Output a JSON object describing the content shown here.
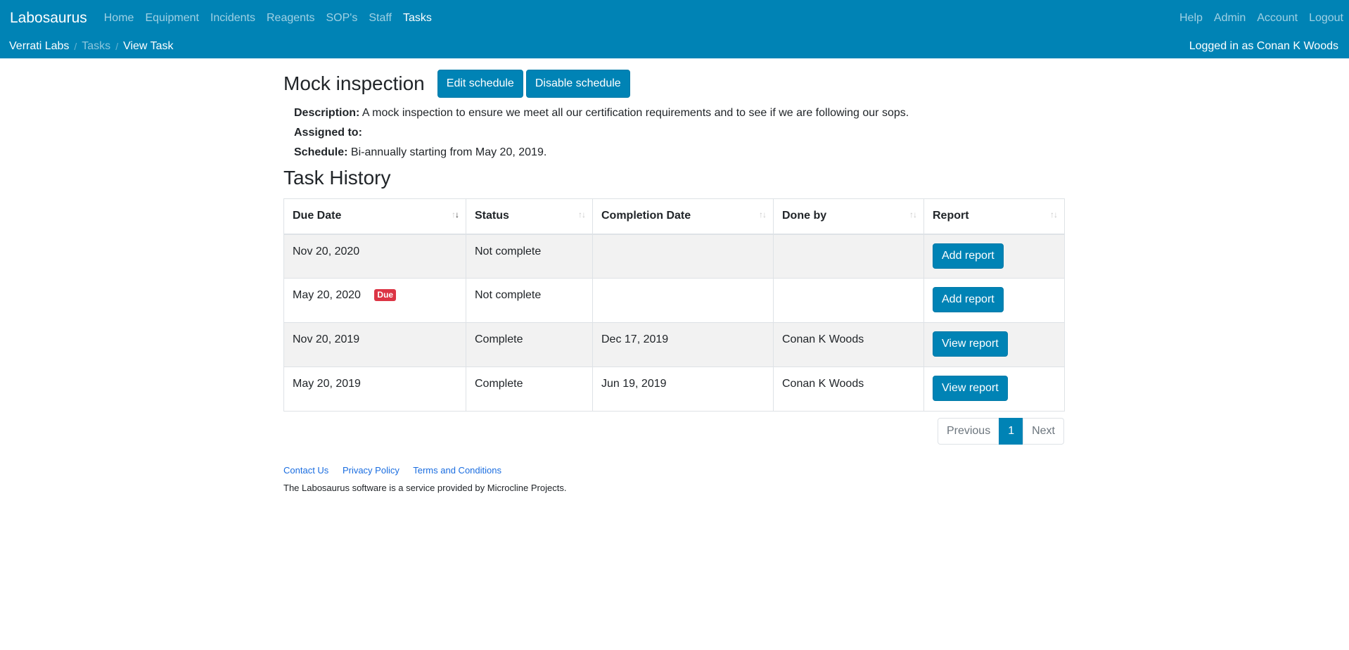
{
  "nav": {
    "brand": "Labosaurus",
    "links": [
      "Home",
      "Equipment",
      "Incidents",
      "Reagents",
      "SOP's",
      "Staff",
      "Tasks"
    ],
    "right_links": [
      "Help",
      "Admin",
      "Account",
      "Logout"
    ]
  },
  "breadcrumb": {
    "lab": "Verrati Labs",
    "tasks": "Tasks",
    "current": "View Task",
    "separator": "/"
  },
  "user": {
    "logged_in": "Logged in as Conan K Woods"
  },
  "task": {
    "title": "Mock inspection",
    "edit_label": "Edit schedule",
    "disable_label": "Disable schedule",
    "description_label": "Description:",
    "description": "A mock inspection to ensure we meet all our certification requirements and to see if we are following our sops.",
    "assigned_label": "Assigned to:",
    "assigned": "",
    "schedule_label": "Schedule:",
    "schedule": "Bi-annually starting from May 20, 2019."
  },
  "history": {
    "title": "Task History",
    "columns": [
      "Due Date",
      "Status",
      "Completion Date",
      "Done by",
      "Report"
    ],
    "rows": [
      {
        "due": "Nov 20, 2020",
        "badge": "",
        "status": "Not complete",
        "completed": "",
        "done_by": "",
        "action": "Add report"
      },
      {
        "due": "May 20, 2020",
        "badge": "Due",
        "status": "Not complete",
        "completed": "",
        "done_by": "",
        "action": "Add report"
      },
      {
        "due": "Nov 20, 2019",
        "badge": "",
        "status": "Complete",
        "completed": "Dec 17, 2019",
        "done_by": "Conan K Woods",
        "action": "View report"
      },
      {
        "due": "May 20, 2019",
        "badge": "",
        "status": "Complete",
        "completed": "Jun 19, 2019",
        "done_by": "Conan K Woods",
        "action": "View report"
      }
    ]
  },
  "pagination": {
    "previous": "Previous",
    "current": "1",
    "next": "Next"
  },
  "footer": {
    "links": [
      "Contact Us",
      "Privacy Policy",
      "Terms and Conditions"
    ],
    "note": "The Labosaurus software is a service provided by Microcline Projects."
  },
  "colors": {
    "primary": "#0083b5",
    "danger": "#dc3545",
    "link": "#1a6de0"
  }
}
